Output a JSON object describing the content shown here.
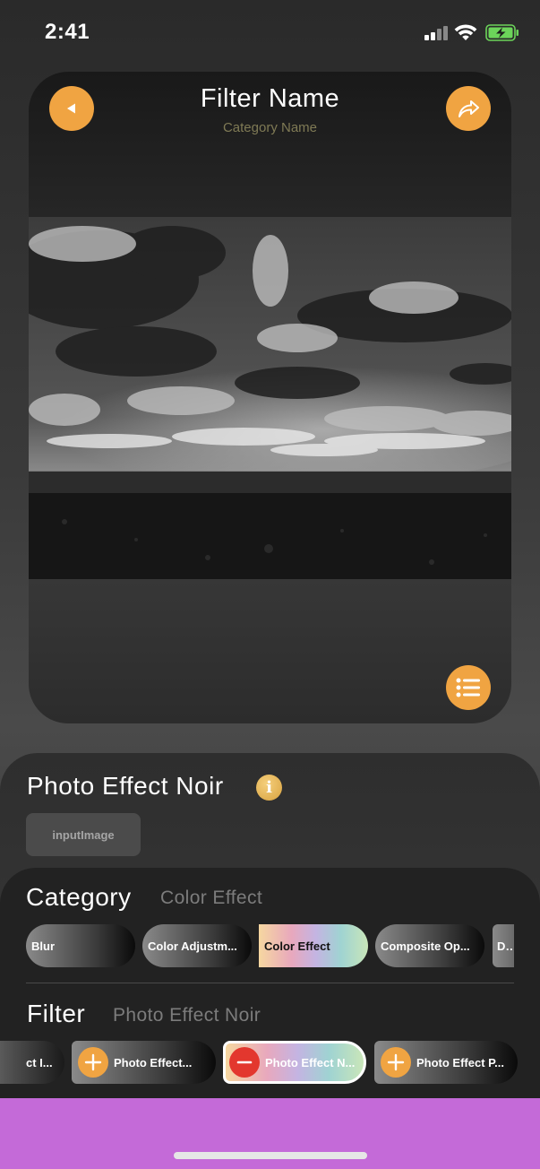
{
  "status_bar": {
    "time": "2:41"
  },
  "preview": {
    "title": "Filter Name",
    "subtitle": "Category Name"
  },
  "effect": {
    "name": "Photo Effect Noir",
    "input_label": "inputImage"
  },
  "category_section": {
    "title": "Category",
    "selected": "Color Effect",
    "pills": [
      {
        "label": "Blur"
      },
      {
        "label": "Color Adjustm..."
      },
      {
        "label": "Color Effect"
      },
      {
        "label": "Composite Op..."
      },
      {
        "label": "Dis"
      }
    ]
  },
  "filter_section": {
    "title": "Filter",
    "selected": "Photo Effect Noir",
    "pills": [
      {
        "label": "ct I..."
      },
      {
        "label": "Photo Effect..."
      },
      {
        "label": "Photo Effect N..."
      },
      {
        "label": "Photo Effect P..."
      }
    ]
  },
  "colors": {
    "accent": "#f0a442",
    "remove": "#e3372e",
    "bottom_bar": "#c46ad8"
  },
  "icons": {
    "back": "back-triangle-icon",
    "share": "share-arrow-icon",
    "menu": "list-icon",
    "info": "info-icon",
    "add": "plus-icon",
    "remove": "minus-icon"
  }
}
